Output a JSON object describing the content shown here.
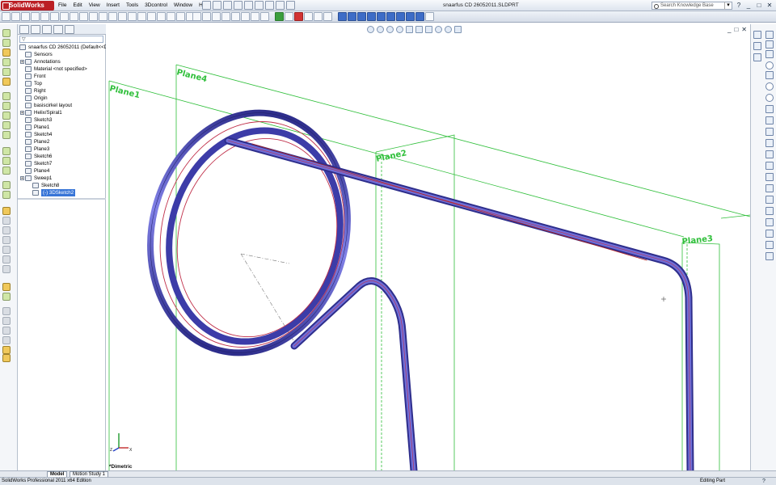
{
  "app": {
    "logo": "SolidWorks",
    "document_title": "snaarfus CD 26052011.SLDPRT",
    "menu": [
      "File",
      "Edit",
      "View",
      "Insert",
      "Tools",
      "3Dcontrol",
      "Window",
      "Help"
    ],
    "search_placeholder": "Search Knowledge Base",
    "search_button": "▾",
    "help_glyph": "?",
    "window_controls": [
      "_",
      "□",
      "✕"
    ]
  },
  "feature_tree": {
    "items": [
      {
        "label": "snaarfus CD 26052011  (Default<<De",
        "depth": 0,
        "icon": "part-icon",
        "selected": false
      },
      {
        "label": "Sensors",
        "depth": 1,
        "icon": "sensors-folder-icon",
        "selected": false
      },
      {
        "label": "Annotations",
        "depth": 1,
        "icon": "annotations-icon",
        "selected": false
      },
      {
        "label": "Material <not specified>",
        "depth": 1,
        "icon": "material-icon",
        "selected": false
      },
      {
        "label": "Front",
        "depth": 1,
        "icon": "plane-icon",
        "selected": false
      },
      {
        "label": "Top",
        "depth": 1,
        "icon": "plane-icon",
        "selected": false
      },
      {
        "label": "Right",
        "depth": 1,
        "icon": "plane-icon",
        "selected": false
      },
      {
        "label": "Origin",
        "depth": 1,
        "icon": "origin-icon",
        "selected": false
      },
      {
        "label": "basiscirkel layout",
        "depth": 1,
        "icon": "sketch-icon",
        "selected": false
      },
      {
        "label": "Helix/Spiral1",
        "depth": 1,
        "icon": "helix-icon",
        "selected": false
      },
      {
        "label": "Sketch3",
        "depth": 1,
        "icon": "sketch-icon",
        "selected": false
      },
      {
        "label": "Plane1",
        "depth": 1,
        "icon": "plane-icon",
        "selected": false
      },
      {
        "label": "Sketch4",
        "depth": 1,
        "icon": "sketch-icon",
        "selected": false
      },
      {
        "label": "Plane2",
        "depth": 1,
        "icon": "plane-icon",
        "selected": false
      },
      {
        "label": "Plane3",
        "depth": 1,
        "icon": "plane-icon",
        "selected": false
      },
      {
        "label": "Sketch6",
        "depth": 1,
        "icon": "sketch-icon",
        "selected": false
      },
      {
        "label": "Sketch7",
        "depth": 1,
        "icon": "sketch-icon",
        "selected": false
      },
      {
        "label": "Plane4",
        "depth": 1,
        "icon": "plane-icon",
        "selected": false
      },
      {
        "label": "Sweep1",
        "depth": 1,
        "icon": "sweep-icon",
        "selected": false
      },
      {
        "label": "Sketch8",
        "depth": 2,
        "icon": "sketch-icon",
        "selected": false
      },
      {
        "label": "(-) 3DSketch2",
        "depth": 2,
        "icon": "3dsketch-icon",
        "selected": true
      }
    ]
  },
  "viewport": {
    "plane_labels": [
      "Plane4",
      "Plane1",
      "Plane2",
      "Plane3"
    ],
    "view_orientation": "*Dimetric",
    "window_controls": [
      "_",
      "□",
      "✕"
    ]
  },
  "tabs": [
    "Model",
    "Motion Study 1"
  ],
  "status": {
    "edition": "SolidWorks Professional 2011 x64 Edition",
    "mode": "Editing Part",
    "help_glyph": "?"
  },
  "colors": {
    "plane": "#2fbf3a",
    "spring_body": "#4646b8",
    "spring_highlight": "#7f7fe0",
    "spring_edge": "#c0304a",
    "selection": "#3875d7"
  }
}
